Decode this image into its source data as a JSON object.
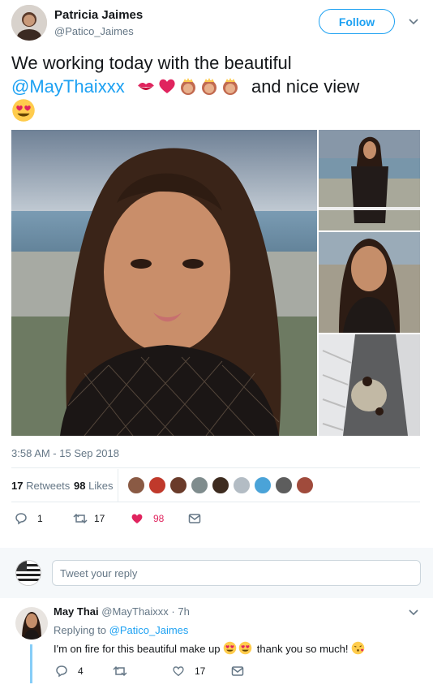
{
  "author": {
    "name": "Patricia Jaimes",
    "handle": "@Patico_Jaimes"
  },
  "follow_label": "Follow",
  "tweet": {
    "line1": "We working today with the beautiful",
    "mention": "@MayThaixxx",
    "after_emoji": "and nice view",
    "emoji_sequence": [
      "kiss-mark",
      "red-heart",
      "princess",
      "princess",
      "princess"
    ],
    "final_emoji": "heart-eyes-face"
  },
  "timestamp": "3:58 AM - 15 Sep 2018",
  "stats": {
    "retweets_count": "17",
    "retweets_label": "Retweets",
    "likes_count": "98",
    "likes_label": "Likes"
  },
  "likers": [
    "#8a5a44",
    "#c0392b",
    "#6a3b2a",
    "#7f8c8d",
    "#3d2b1f",
    "#b3bcc4",
    "#4aa3d8",
    "#5d5d5d",
    "#a04b3c"
  ],
  "actions": {
    "reply_count": "1",
    "retweet_count": "17",
    "like_count": "98"
  },
  "reply_box": {
    "placeholder": "Tweet your reply"
  },
  "reply": {
    "name": "May Thai",
    "handle": "@MayThaixxx",
    "time": "· 7h",
    "replying_label": "Replying to",
    "replying_to": "@Patico_Jaimes",
    "text_part1": "I'm on fire for this beautiful make up",
    "text_part2": "thank you so much!",
    "emoji_sequence": [
      "heart-eyes-face",
      "heart-eyes-face"
    ],
    "end_emoji": "face-blowing-kiss",
    "reply_count": "4",
    "like_count": "17"
  },
  "colors": {
    "accent": "#1da1f2",
    "like": "#e0245e",
    "text": "#14171a",
    "muted": "#657786"
  }
}
